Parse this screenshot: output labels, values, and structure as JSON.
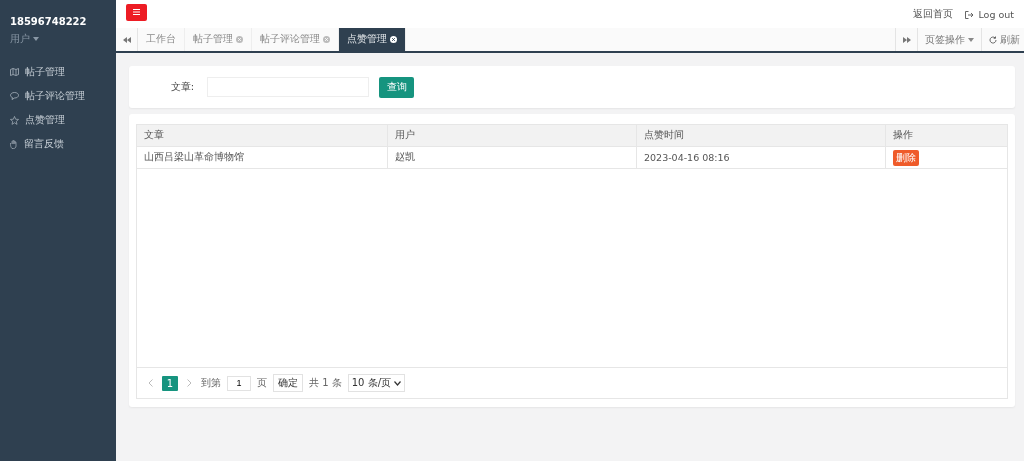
{
  "sidebar": {
    "username": "18596748222",
    "role": "用户",
    "items": [
      {
        "label": "帖子管理",
        "selected": false
      },
      {
        "label": "帖子评论管理",
        "selected": false
      },
      {
        "label": "点赞管理",
        "selected": false
      },
      {
        "label": "留言反馈",
        "selected": false
      }
    ]
  },
  "header": {
    "links": [
      "返回首页",
      "Log out"
    ]
  },
  "tabs": [
    {
      "label": "工作台",
      "closable": false,
      "selected": false
    },
    {
      "label": "帖子管理",
      "closable": true,
      "selected": false
    },
    {
      "label": "帖子评论管理",
      "closable": true,
      "selected": false
    },
    {
      "label": "点赞管理",
      "closable": true,
      "selected": true
    }
  ],
  "tab_tools": {
    "page_ops": "页签操作",
    "refresh": "刷新"
  },
  "search": {
    "label": "文章:",
    "button": "查询"
  },
  "table": {
    "columns": [
      "文章",
      "用户",
      "点赞时间",
      "操作"
    ],
    "rows": [
      {
        "cells": [
          "山西吕梁山革命博物馆",
          "赵凯",
          "2023-04-16 08:16"
        ],
        "action": "删除"
      }
    ]
  },
  "pagination": {
    "pages": [
      {
        "label": "1",
        "selected": true
      }
    ],
    "goto_prefix": "到第",
    "goto_value": "1",
    "goto_suffix": "页",
    "confirm": "确定",
    "total": "共 1 条",
    "page_size": "10 条/页"
  }
}
